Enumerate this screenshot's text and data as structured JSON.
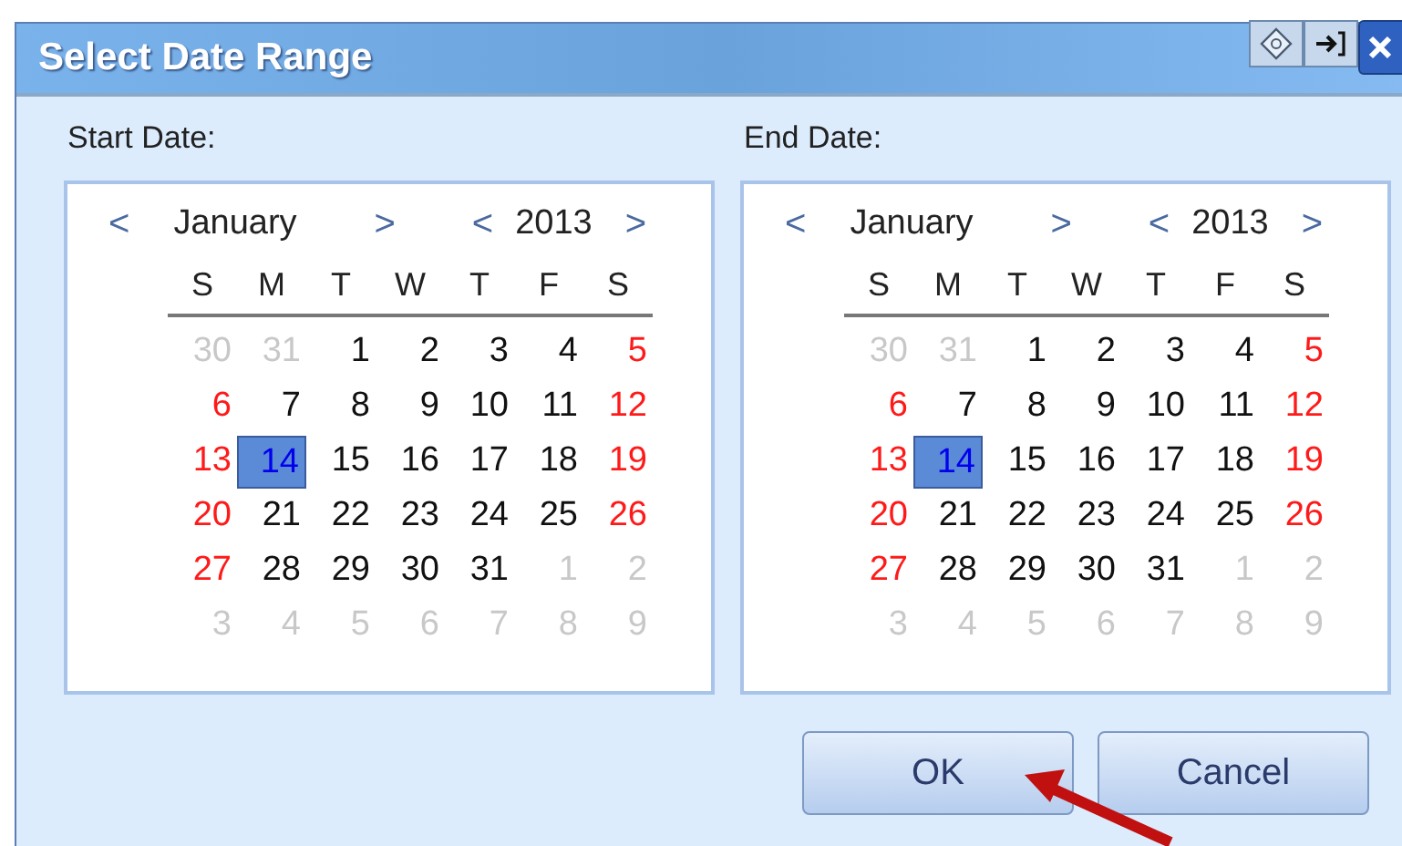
{
  "window": {
    "title": "Select Date Range"
  },
  "calendars": [
    {
      "label": "Start Date:",
      "month": "January",
      "year": "2013",
      "prev_month": "<",
      "next_month": ">",
      "prev_year": "<",
      "next_year": ">",
      "weekdays": [
        "S",
        "M",
        "T",
        "W",
        "T",
        "F",
        "S"
      ],
      "weeks": [
        [
          {
            "day": "30",
            "kind": "other",
            "selected": false
          },
          {
            "day": "31",
            "kind": "other",
            "selected": false
          },
          {
            "day": "1",
            "kind": "normal",
            "selected": false
          },
          {
            "day": "2",
            "kind": "normal",
            "selected": false
          },
          {
            "day": "3",
            "kind": "normal",
            "selected": false
          },
          {
            "day": "4",
            "kind": "normal",
            "selected": false
          },
          {
            "day": "5",
            "kind": "weekend",
            "selected": false
          }
        ],
        [
          {
            "day": "6",
            "kind": "weekend",
            "selected": false
          },
          {
            "day": "7",
            "kind": "normal",
            "selected": false
          },
          {
            "day": "8",
            "kind": "normal",
            "selected": false
          },
          {
            "day": "9",
            "kind": "normal",
            "selected": false
          },
          {
            "day": "10",
            "kind": "normal",
            "selected": false
          },
          {
            "day": "11",
            "kind": "normal",
            "selected": false
          },
          {
            "day": "12",
            "kind": "weekend",
            "selected": false
          }
        ],
        [
          {
            "day": "13",
            "kind": "weekend",
            "selected": false
          },
          {
            "day": "14",
            "kind": "normal",
            "selected": true
          },
          {
            "day": "15",
            "kind": "normal",
            "selected": false
          },
          {
            "day": "16",
            "kind": "normal",
            "selected": false
          },
          {
            "day": "17",
            "kind": "normal",
            "selected": false
          },
          {
            "day": "18",
            "kind": "normal",
            "selected": false
          },
          {
            "day": "19",
            "kind": "weekend",
            "selected": false
          }
        ],
        [
          {
            "day": "20",
            "kind": "weekend",
            "selected": false
          },
          {
            "day": "21",
            "kind": "normal",
            "selected": false
          },
          {
            "day": "22",
            "kind": "normal",
            "selected": false
          },
          {
            "day": "23",
            "kind": "normal",
            "selected": false
          },
          {
            "day": "24",
            "kind": "normal",
            "selected": false
          },
          {
            "day": "25",
            "kind": "normal",
            "selected": false
          },
          {
            "day": "26",
            "kind": "weekend",
            "selected": false
          }
        ],
        [
          {
            "day": "27",
            "kind": "weekend",
            "selected": false
          },
          {
            "day": "28",
            "kind": "normal",
            "selected": false
          },
          {
            "day": "29",
            "kind": "normal",
            "selected": false
          },
          {
            "day": "30",
            "kind": "normal",
            "selected": false
          },
          {
            "day": "31",
            "kind": "normal",
            "selected": false
          },
          {
            "day": "1",
            "kind": "other",
            "selected": false
          },
          {
            "day": "2",
            "kind": "other",
            "selected": false
          }
        ],
        [
          {
            "day": "3",
            "kind": "other",
            "selected": false
          },
          {
            "day": "4",
            "kind": "other",
            "selected": false
          },
          {
            "day": "5",
            "kind": "other",
            "selected": false
          },
          {
            "day": "6",
            "kind": "other",
            "selected": false
          },
          {
            "day": "7",
            "kind": "other",
            "selected": false
          },
          {
            "day": "8",
            "kind": "other",
            "selected": false
          },
          {
            "day": "9",
            "kind": "other",
            "selected": false
          }
        ]
      ]
    },
    {
      "label": "End Date:",
      "month": "January",
      "year": "2013",
      "prev_month": "<",
      "next_month": ">",
      "prev_year": "<",
      "next_year": ">",
      "weekdays": [
        "S",
        "M",
        "T",
        "W",
        "T",
        "F",
        "S"
      ],
      "weeks": [
        [
          {
            "day": "30",
            "kind": "other",
            "selected": false
          },
          {
            "day": "31",
            "kind": "other",
            "selected": false
          },
          {
            "day": "1",
            "kind": "normal",
            "selected": false
          },
          {
            "day": "2",
            "kind": "normal",
            "selected": false
          },
          {
            "day": "3",
            "kind": "normal",
            "selected": false
          },
          {
            "day": "4",
            "kind": "normal",
            "selected": false
          },
          {
            "day": "5",
            "kind": "weekend",
            "selected": false
          }
        ],
        [
          {
            "day": "6",
            "kind": "weekend",
            "selected": false
          },
          {
            "day": "7",
            "kind": "normal",
            "selected": false
          },
          {
            "day": "8",
            "kind": "normal",
            "selected": false
          },
          {
            "day": "9",
            "kind": "normal",
            "selected": false
          },
          {
            "day": "10",
            "kind": "normal",
            "selected": false
          },
          {
            "day": "11",
            "kind": "normal",
            "selected": false
          },
          {
            "day": "12",
            "kind": "weekend",
            "selected": false
          }
        ],
        [
          {
            "day": "13",
            "kind": "weekend",
            "selected": false
          },
          {
            "day": "14",
            "kind": "normal",
            "selected": true
          },
          {
            "day": "15",
            "kind": "normal",
            "selected": false
          },
          {
            "day": "16",
            "kind": "normal",
            "selected": false
          },
          {
            "day": "17",
            "kind": "normal",
            "selected": false
          },
          {
            "day": "18",
            "kind": "normal",
            "selected": false
          },
          {
            "day": "19",
            "kind": "weekend",
            "selected": false
          }
        ],
        [
          {
            "day": "20",
            "kind": "weekend",
            "selected": false
          },
          {
            "day": "21",
            "kind": "normal",
            "selected": false
          },
          {
            "day": "22",
            "kind": "normal",
            "selected": false
          },
          {
            "day": "23",
            "kind": "normal",
            "selected": false
          },
          {
            "day": "24",
            "kind": "normal",
            "selected": false
          },
          {
            "day": "25",
            "kind": "normal",
            "selected": false
          },
          {
            "day": "26",
            "kind": "weekend",
            "selected": false
          }
        ],
        [
          {
            "day": "27",
            "kind": "weekend",
            "selected": false
          },
          {
            "day": "28",
            "kind": "normal",
            "selected": false
          },
          {
            "day": "29",
            "kind": "normal",
            "selected": false
          },
          {
            "day": "30",
            "kind": "normal",
            "selected": false
          },
          {
            "day": "31",
            "kind": "normal",
            "selected": false
          },
          {
            "day": "1",
            "kind": "other",
            "selected": false
          },
          {
            "day": "2",
            "kind": "other",
            "selected": false
          }
        ],
        [
          {
            "day": "3",
            "kind": "other",
            "selected": false
          },
          {
            "day": "4",
            "kind": "other",
            "selected": false
          },
          {
            "day": "5",
            "kind": "other",
            "selected": false
          },
          {
            "day": "6",
            "kind": "other",
            "selected": false
          },
          {
            "day": "7",
            "kind": "other",
            "selected": false
          },
          {
            "day": "8",
            "kind": "other",
            "selected": false
          },
          {
            "day": "9",
            "kind": "other",
            "selected": false
          }
        ]
      ]
    }
  ],
  "buttons": [
    "OK",
    "Cancel"
  ]
}
